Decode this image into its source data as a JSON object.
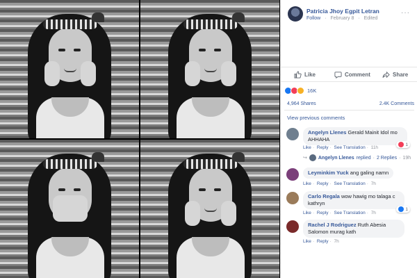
{
  "post": {
    "author": "Patricia Jhoy Egpit Letran",
    "follow": "Follow",
    "date": "February 8",
    "edited": "Edited",
    "separator": "·",
    "more": "···"
  },
  "actions": {
    "like": "Like",
    "comment": "Comment",
    "share": "Share"
  },
  "reactions": {
    "count": "16K"
  },
  "stats": {
    "shares": "4,964 Shares",
    "comments": "2.4K Comments"
  },
  "view_previous": "View previous comments",
  "comments": [
    {
      "name": "Angelyn Llenes",
      "text": "Gerald Mainit Idol mo AHHAHA",
      "like": "Like",
      "reply": "Reply",
      "see_translation": "See Translation",
      "time": "11h",
      "reaction_count": "1",
      "avatar_color": "#6f7f8f"
    },
    {
      "name": "Leyminkim Yuck",
      "text": "ang galing namn",
      "like": "Like",
      "reply": "Reply",
      "see_translation": "See Translation",
      "time": "7h",
      "avatar_color": "#7b3f7a"
    },
    {
      "name": "Carlo Regala",
      "text": "wow hawig mo talaga c kathryn",
      "like": "Like",
      "reply": "Reply",
      "see_translation": "See Translation",
      "time": "7h",
      "reaction_count": "1",
      "avatar_color": "#9a7b5a"
    },
    {
      "name": "Rachel J Rodriguez",
      "text": "Ruth Abesia Salomon murag kath",
      "like": "Like",
      "reply": "Reply",
      "time": "7h",
      "avatar_color": "#7a2a2a"
    }
  ],
  "replies_line": {
    "name": "Angelyn Llenes",
    "text": "replied",
    "count": "2 Replies",
    "time": "19h"
  },
  "colors": {
    "link_blue": "#365899",
    "fb_blue": "#1877f2",
    "love_red": "#f33e58",
    "wow_yellow": "#f7b125"
  }
}
